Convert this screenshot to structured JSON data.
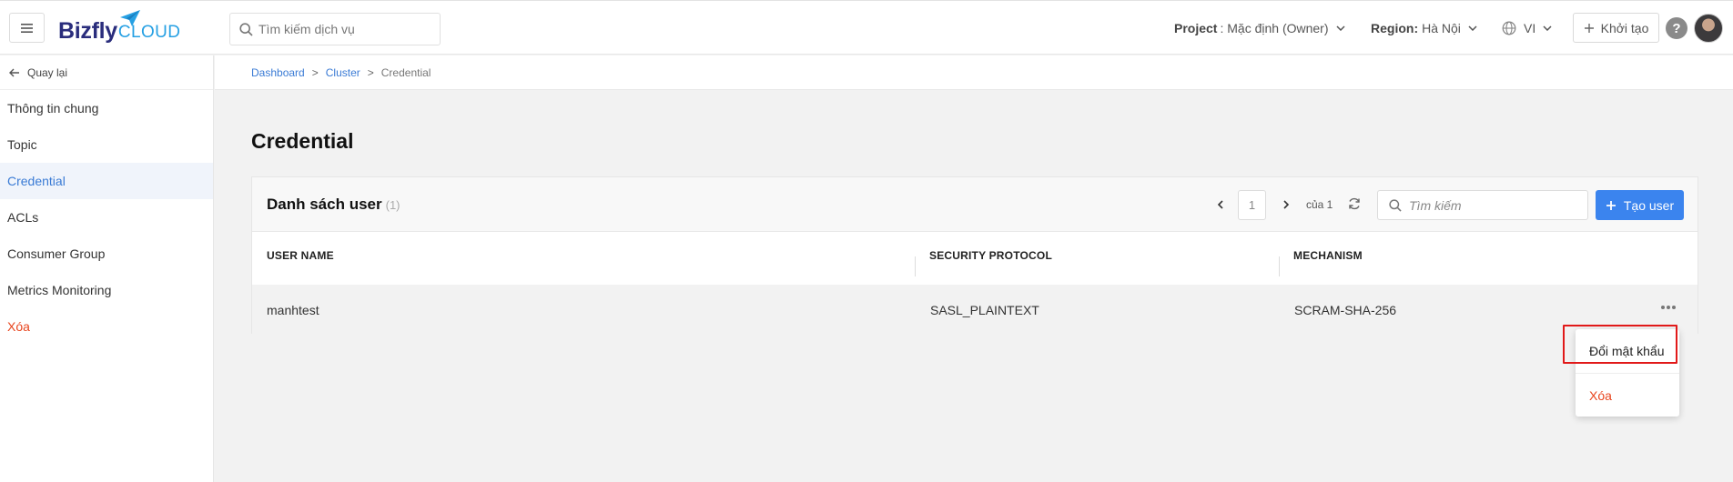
{
  "header": {
    "logo_main": "Bizfly",
    "logo_sub": "CLOUD",
    "search_placeholder": "Tìm kiếm dịch vụ",
    "project_label": "Project",
    "project_value": ": Mặc định (Owner)",
    "region_label": "Region:",
    "region_value": "Hà Nội",
    "lang_value": "VI",
    "create_label": "Khởi tạo",
    "help_label": "?"
  },
  "sidebar": {
    "back_label": "Quay lại",
    "items": [
      {
        "label": "Thông tin chung"
      },
      {
        "label": "Topic"
      },
      {
        "label": "Credential"
      },
      {
        "label": "ACLs"
      },
      {
        "label": "Consumer Group"
      },
      {
        "label": "Metrics Monitoring"
      },
      {
        "label": "Xóa"
      }
    ]
  },
  "breadcrumb": {
    "items": [
      "Dashboard",
      "Cluster",
      "Credential"
    ],
    "separator": ">"
  },
  "page": {
    "title": "Credential"
  },
  "card": {
    "title": "Danh sách user",
    "count": "(1)",
    "page_number": "1",
    "page_of": "của 1",
    "search_placeholder": "Tìm kiếm",
    "create_button": "Tạo user",
    "columns": [
      "USER NAME",
      "SECURITY PROTOCOL",
      "MECHANISM"
    ],
    "rows": [
      {
        "user_name": "manhtest",
        "security_protocol": "SASL_PLAINTEXT",
        "mechanism": "SCRAM-SHA-256"
      }
    ]
  },
  "dropdown": {
    "items": [
      "Đổi mật khẩu",
      "Xóa"
    ]
  },
  "colors": {
    "primary": "#3b84ee",
    "link": "#3a7bd5",
    "danger": "#e8451e",
    "highlight": "#e11919"
  }
}
